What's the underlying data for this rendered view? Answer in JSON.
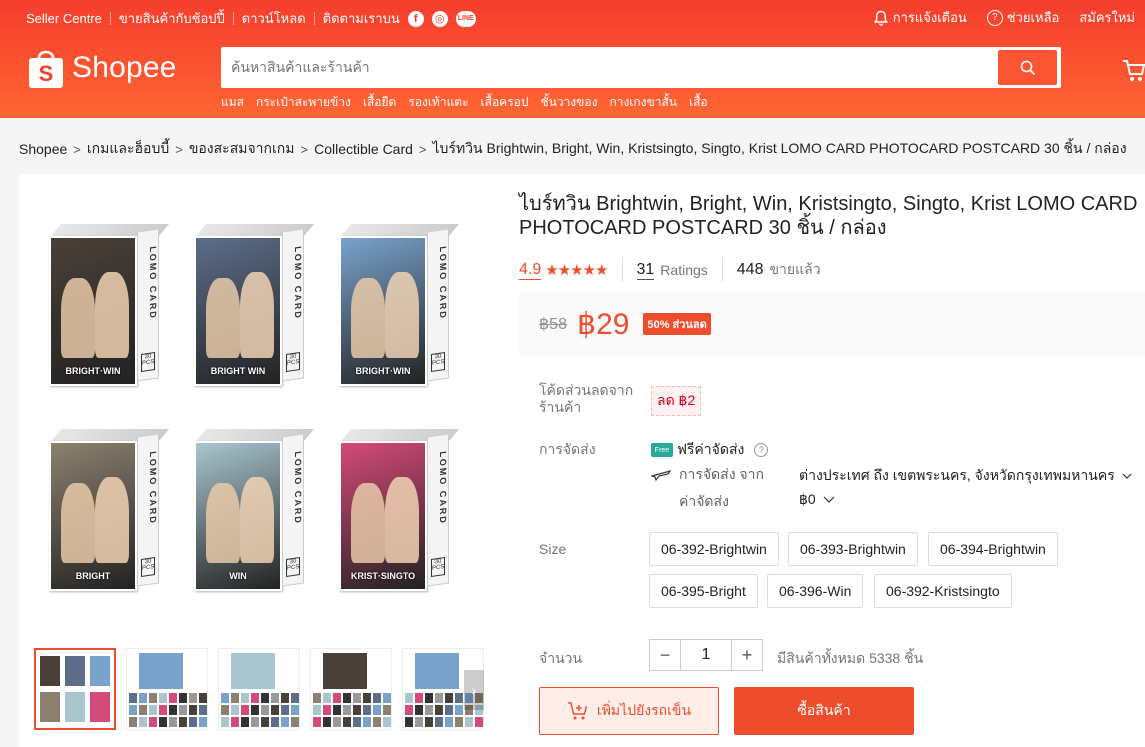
{
  "topbar": {
    "left": [
      "Seller Centre",
      "ขายสินค้ากับช้อปปี้",
      "ดาวน์โหลด",
      "ติดตามเราบน"
    ],
    "social": [
      "f",
      "◎",
      "LINE"
    ],
    "notifications": "การแจ้งเตือน",
    "help": "ช่วยเหลือ",
    "signup": "สมัครใหม่"
  },
  "logo": {
    "text": "Shopee",
    "letter": "S"
  },
  "search": {
    "placeholder": "ค้นหาสินค้าและร้านค้า",
    "value": ""
  },
  "hint_links": [
    "แมส",
    "กระเป๋าสะพายข้าง",
    "เสื้อยืด",
    "รองเท้าแตะ",
    "เสื้อครอป",
    "ชั้นวางของ",
    "กางเกงขาสั้น",
    "เสื้อ"
  ],
  "breadcrumb": [
    "Shopee",
    "เกมและฮ็อบบี้",
    "ของสะสมจากเกม",
    "Collectible Card",
    "ไบร์ทวิน Brightwin, Bright, Win, Kristsingto, Singto, Krist LOMO CARD PHOTOCARD POSTCARD 30 ชิ้น / กล่อง"
  ],
  "gallery": {
    "boxes": [
      {
        "side_text": "LOMO CARD",
        "top_text": "BRIGHT WIN",
        "caption": "BRIGHT·WIN",
        "pcs": "30 PCS",
        "bg": "#4a4038"
      },
      {
        "side_text": "LOMO CARD",
        "top_text": "BRIGHT WIN",
        "caption": "BRIGHT WIN",
        "pcs": "30 PCS",
        "bg": "#5d6e8a"
      },
      {
        "side_text": "LOMO CARD",
        "top_text": "BRIGHT WIN",
        "caption": "BRIGHT·WIN",
        "pcs": "30 PCS",
        "bg": "#7aa3cc"
      },
      {
        "side_text": "LOMO CARD",
        "top_text": "BRIGHT",
        "caption": "BRIGHT",
        "pcs": "30 PCS",
        "bg": "#8c8170"
      },
      {
        "side_text": "LOMO CARD",
        "top_text": "WIN",
        "caption": "WIN",
        "pcs": "30 PCS",
        "bg": "#a9c6cf"
      },
      {
        "side_text": "LOMO CARD",
        "top_text": "KRIST SINGTO",
        "caption": "KRIST·SINGTO",
        "pcs": "30 PCS",
        "bg": "#d44a7a"
      }
    ],
    "thumb_count": 5,
    "prev_arrow": "‹",
    "next_arrow": "›"
  },
  "product": {
    "title": "ไบร์ทวิน Brightwin, Bright, Win, Kristsingto, Singto, Krist LOMO CARD PHOTOCARD POSTCARD 30 ชิ้น / กล่อง",
    "rating": "4.9",
    "stars": "★★★★★",
    "ratings_count": "31",
    "ratings_label": "Ratings",
    "sold_count": "448",
    "sold_label": "ขายแล้ว",
    "old_price": "฿58",
    "price": "฿29",
    "discount": "50% ส่วนลด"
  },
  "voucher": {
    "label": "โค้ดส่วนลดจากร้านค้า",
    "chip": "ลด ฿2"
  },
  "shipping": {
    "label": "การจัดส่ง",
    "free_icon": "Free",
    "free_text": "ฟรีค่าจัดส่ง",
    "from_label": "การจัดส่ง จาก",
    "location": "ต่างประเทศ ถึง เขตพระนคร, จังหวัดกรุงเทพมหานคร",
    "fee_label": "ค่าจัดส่ง",
    "fee": "฿0"
  },
  "size": {
    "label": "Size",
    "options": [
      "06-392-Brightwin",
      "06-393-Brightwin",
      "06-394-Brightwin",
      "06-395-Bright",
      "06-396-Win",
      "06-392-Kristsingto"
    ]
  },
  "quantity": {
    "label": "จำนวน",
    "minus": "−",
    "value": "1",
    "plus": "+",
    "stock": "มีสินค้าทั้งหมด 5338 ชิ้น"
  },
  "actions": {
    "add_to_cart": "เพิ่มไปยังรถเข็น",
    "buy_now": "ซื้อสินค้า"
  },
  "colors": {
    "brand": "#ee4d2d",
    "header_top": "#f53d2d",
    "header_bottom": "#ff6633"
  }
}
